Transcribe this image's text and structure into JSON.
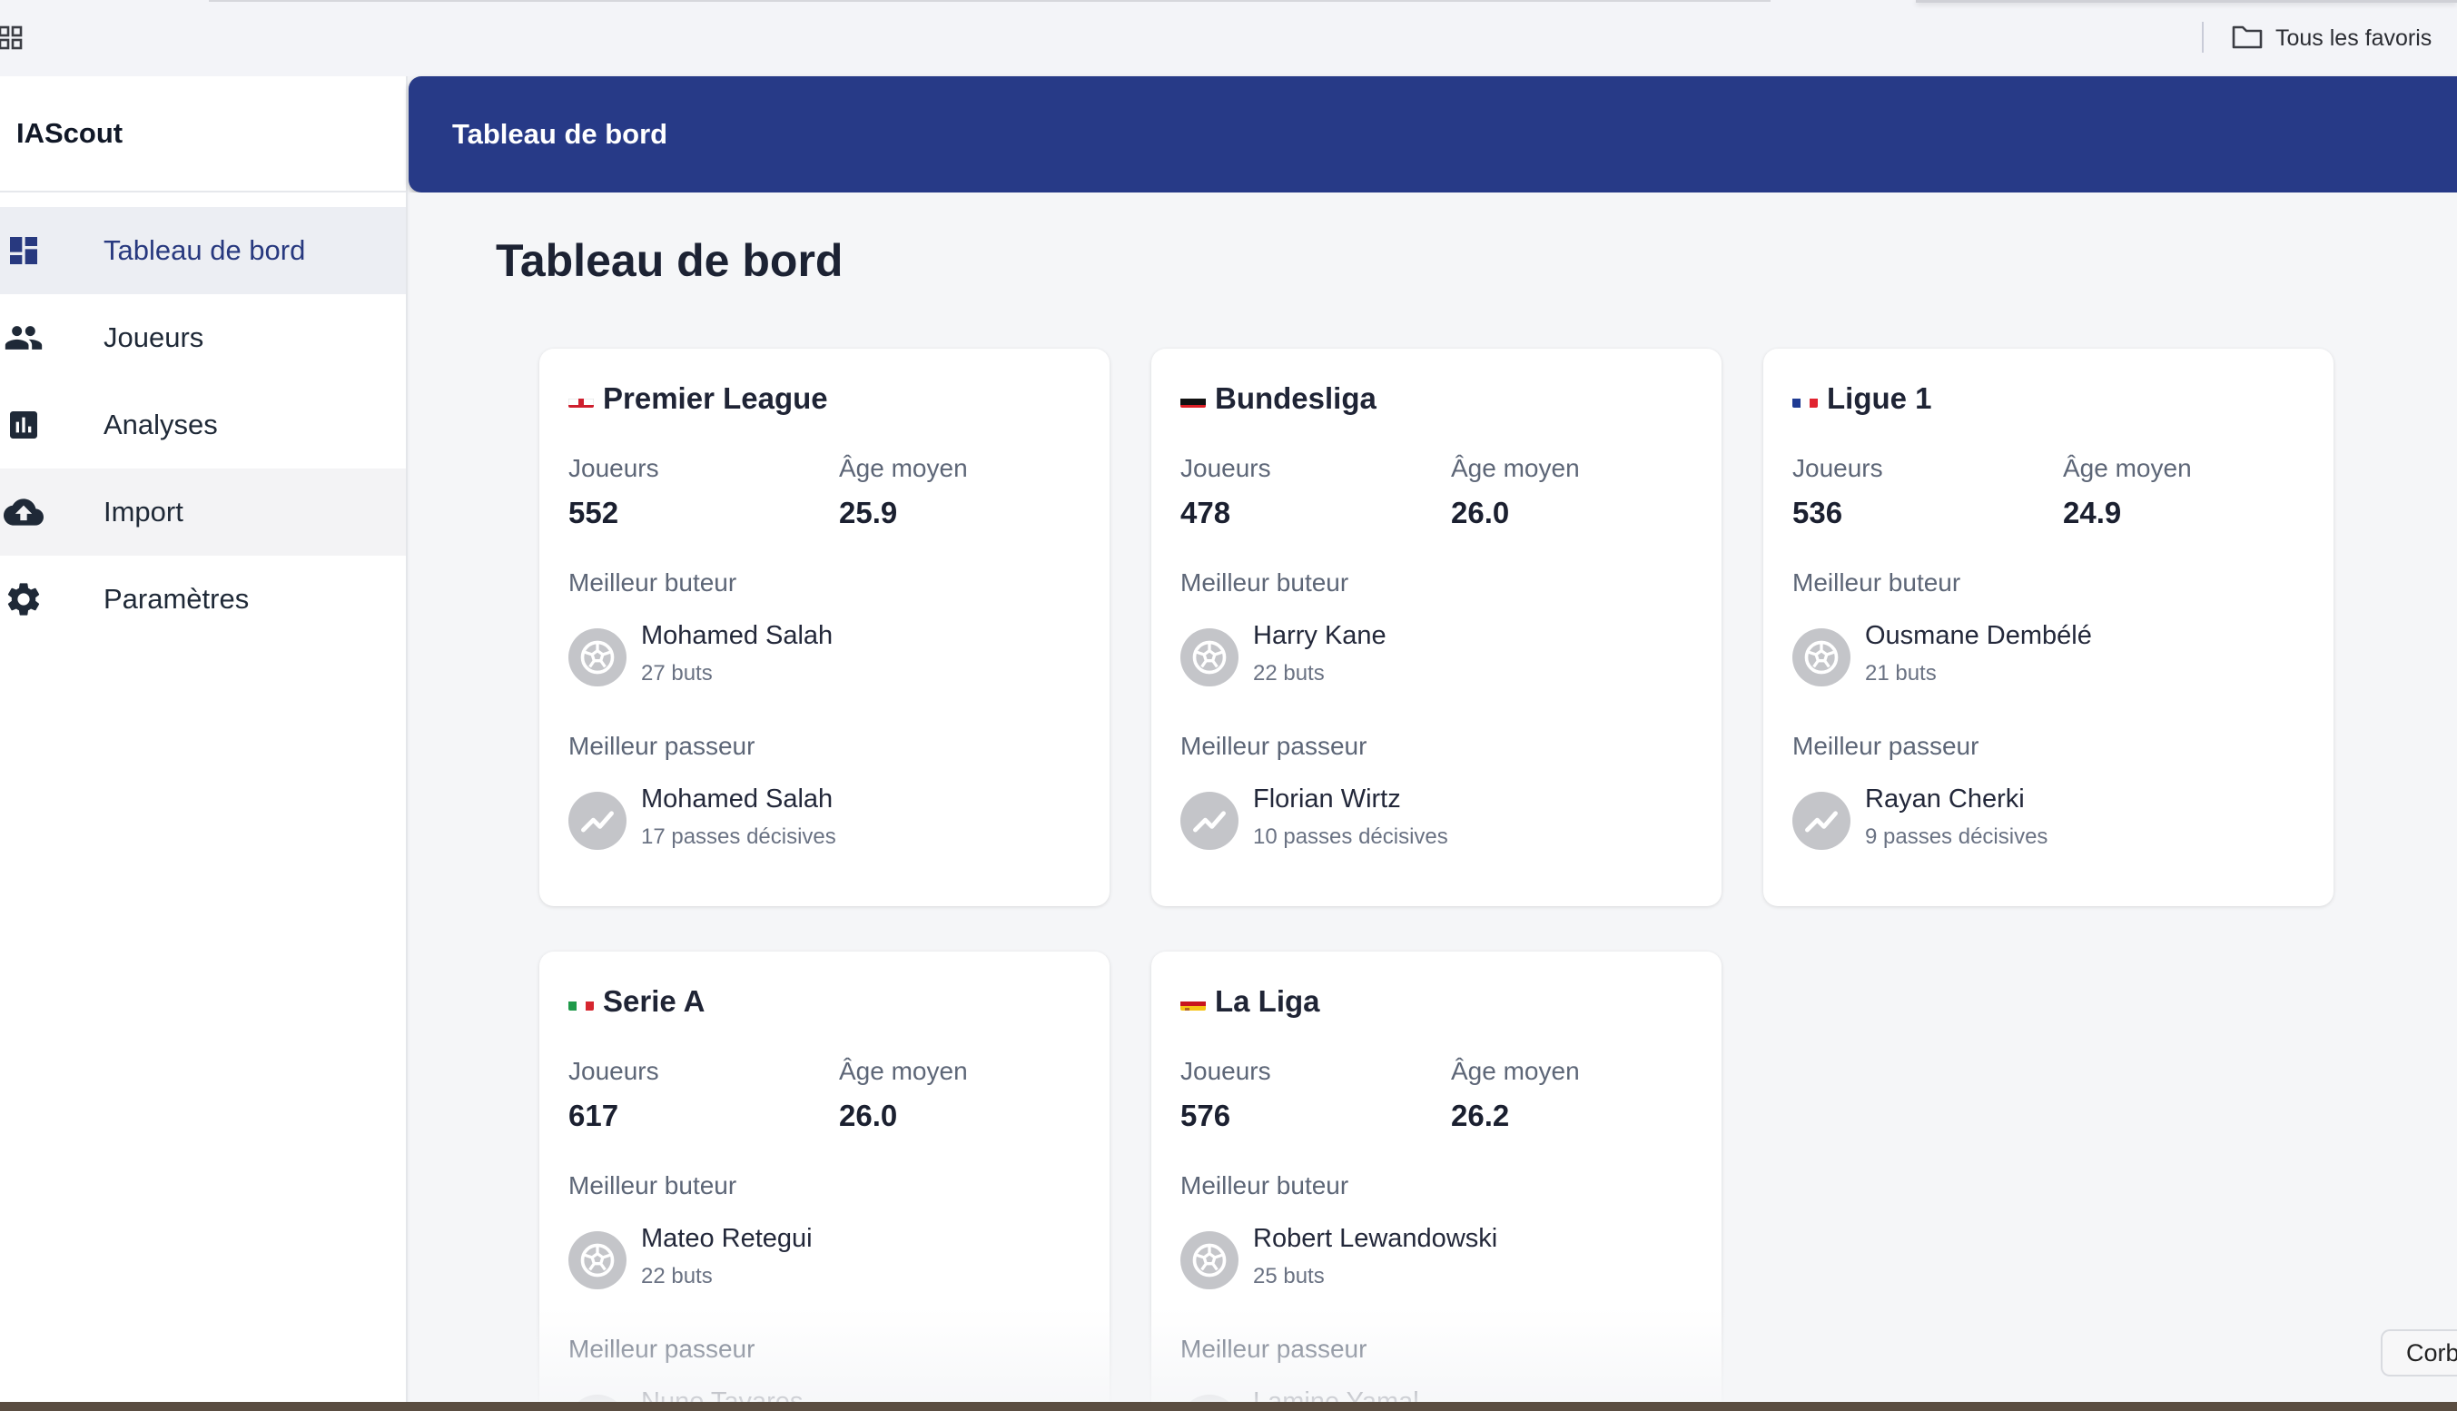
{
  "browser": {
    "bookmarks_folder": "Tous les favoris"
  },
  "sidebar": {
    "brand": "IAScout",
    "items": [
      {
        "label": "Tableau de bord",
        "icon": "dashboard-icon"
      },
      {
        "label": "Joueurs",
        "icon": "people-icon"
      },
      {
        "label": "Analyses",
        "icon": "bar-chart-icon"
      },
      {
        "label": "Import",
        "icon": "cloud-upload-icon"
      },
      {
        "label": "Paramètres",
        "icon": "gear-icon"
      }
    ]
  },
  "header": {
    "title": "Tableau de bord"
  },
  "main": {
    "title": "Tableau de bord",
    "labels": {
      "players": "Joueurs",
      "avg_age": "Âge moyen",
      "top_scorer": "Meilleur buteur",
      "top_assister": "Meilleur passeur"
    },
    "leagues": [
      {
        "name": "Premier League",
        "flag": "england",
        "players": "552",
        "avg_age": "25.9",
        "scorer": {
          "name": "Mohamed Salah",
          "stat": "27 buts"
        },
        "assister": {
          "name": "Mohamed Salah",
          "stat": "17 passes décisives"
        }
      },
      {
        "name": "Bundesliga",
        "flag": "germany",
        "players": "478",
        "avg_age": "26.0",
        "scorer": {
          "name": "Harry Kane",
          "stat": "22 buts"
        },
        "assister": {
          "name": "Florian Wirtz",
          "stat": "10 passes décisives"
        }
      },
      {
        "name": "Ligue 1",
        "flag": "france",
        "players": "536",
        "avg_age": "24.9",
        "scorer": {
          "name": "Ousmane Dembélé",
          "stat": "21 buts"
        },
        "assister": {
          "name": "Rayan Cherki",
          "stat": "9 passes décisives"
        }
      },
      {
        "name": "Serie A",
        "flag": "italy",
        "players": "617",
        "avg_age": "26.0",
        "scorer": {
          "name": "Mateo Retegui",
          "stat": "22 buts"
        },
        "assister": {
          "name": "Nuno Tavares",
          "stat": ""
        }
      },
      {
        "name": "La Liga",
        "flag": "spain",
        "players": "576",
        "avg_age": "26.2",
        "scorer": {
          "name": "Robert Lewandowski",
          "stat": "25 buts"
        },
        "assister": {
          "name": "Lamine Yamal",
          "stat": ""
        }
      }
    ]
  },
  "corner_button": "Corb",
  "colors": {
    "primary": "#273a87",
    "active_nav_bg": "#eceef3",
    "avatar_bg": "#c4c5c9"
  }
}
